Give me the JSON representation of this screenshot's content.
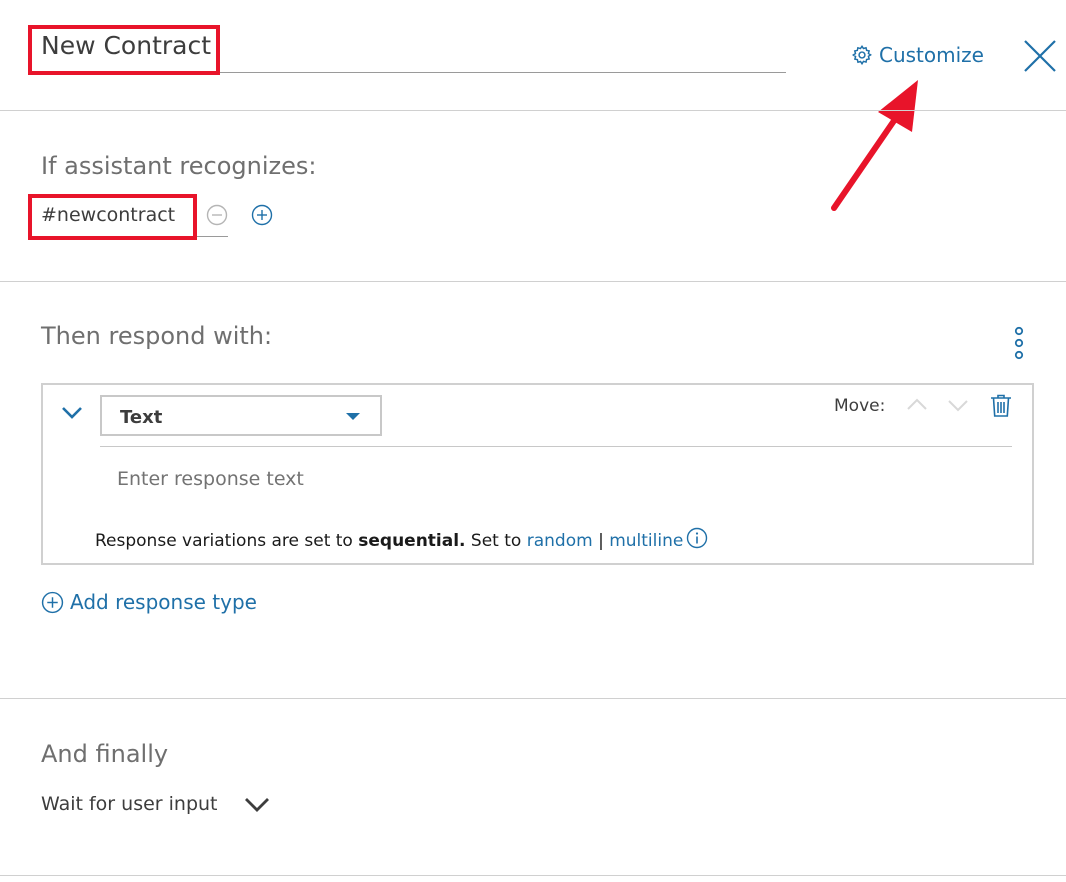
{
  "header": {
    "title": "New Contract",
    "customize_label": "Customize",
    "close_icon": "close-icon",
    "customize_icon": "gear-icon"
  },
  "condition": {
    "label": "If assistant recognizes:",
    "value": "#newcontract",
    "remove_icon": "minus-circle-icon",
    "add_icon": "plus-circle-icon"
  },
  "response": {
    "label": "Then respond with:",
    "menu_icon": "overflow-menu-vertical-icon",
    "type_selected": "Text",
    "move_label": "Move:",
    "input_value": "",
    "input_placeholder": "Enter response text",
    "variations_prefix": "Response variations are set to",
    "variations_mode": "sequential.",
    "variations_set_to": "Set to",
    "option_random": "random",
    "option_separator": "|",
    "option_multiline": "multiline",
    "add_response_label": "Add response type"
  },
  "finally": {
    "label": "And finally",
    "value": "Wait for user input"
  },
  "colors": {
    "accent": "#1f70a8",
    "highlight_red": "#e8142a",
    "divider": "#d0d0d0"
  }
}
